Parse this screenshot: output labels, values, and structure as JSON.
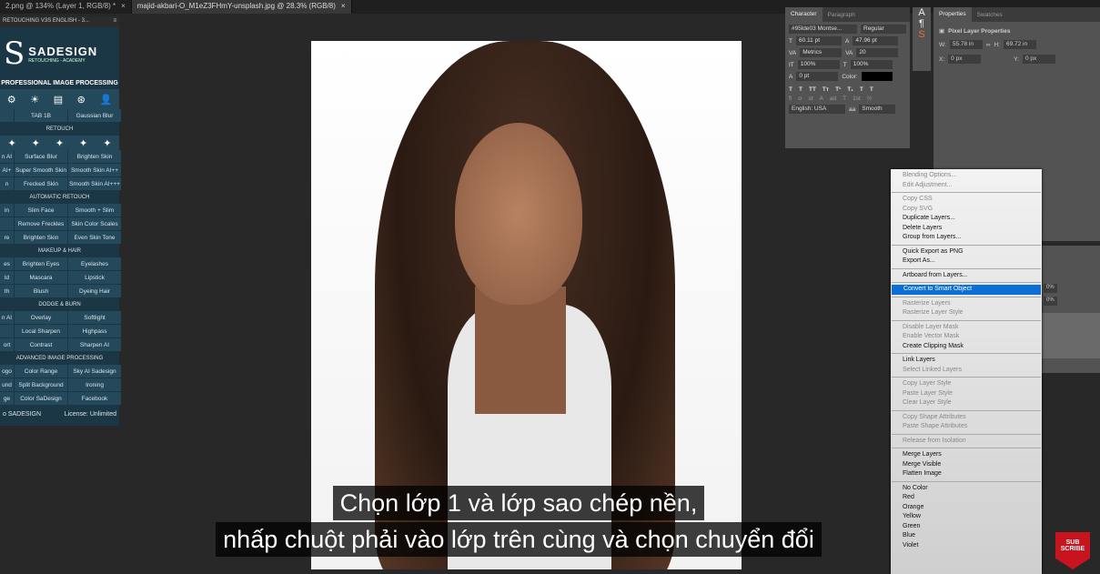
{
  "tabs": [
    {
      "label": "2.png @ 134% (Layer 1, RGB/8) *",
      "close": "×"
    },
    {
      "label": "majid-akbari-O_M1eZ3FHmY-unsplash.jpg @ 28.3% (RGB/8)",
      "close": "×"
    }
  ],
  "sade": {
    "title": "RETOUCHING V3S ENGLISH - 3...",
    "brand": "SADESIGN",
    "brand_sub": "RETOUCHING - ACADEMY",
    "logo_letter": "S",
    "heading": "PROFESSIONAL IMAGE PROCESSING",
    "sections": [
      {
        "header": "",
        "rows": [
          [
            "",
            "TAB 1B",
            "Gaussian Blur"
          ]
        ]
      },
      {
        "header": "RETOUCH",
        "rows": [
          [
            "n AI",
            "Surface Blur",
            "Brighten Skin"
          ],
          [
            "AI+",
            "Super Smooth Skin",
            "Smooth Skin AI++"
          ],
          [
            "n",
            "Frecked Skin",
            "Smooth Skin AI+++"
          ]
        ]
      },
      {
        "header": "AUTOMATIC RETOUCH",
        "rows": [
          [
            "in",
            "Slim Face",
            "Smooth + Slim"
          ],
          [
            "",
            "Remove Freckles",
            "Skin Color Scales"
          ],
          [
            "re",
            "Brighten Skin",
            "Even Skin Tone"
          ]
        ]
      },
      {
        "header": "MAKEUP & HAIR",
        "rows": [
          [
            "es",
            "Brighten Eyes",
            "Eyelashes"
          ],
          [
            "ld",
            "Mascara",
            "Lipstick"
          ],
          [
            "th",
            "Blush",
            "Dyeing Hair"
          ]
        ]
      },
      {
        "header": "DODGE & BURN",
        "rows": [
          [
            "n AI",
            "Overlay",
            "Softlight"
          ],
          [
            "",
            "Local Sharpen",
            "Highpass"
          ],
          [
            "ort",
            "Contrast",
            "Sharpen AI"
          ]
        ]
      },
      {
        "header": "ADVANCED IMAGE PROCESSING",
        "rows": [
          [
            "ogo",
            "Color Range",
            "Sky AI Sadesign"
          ],
          [
            "und",
            "Split Background",
            "Ironing"
          ],
          [
            "ge",
            "Color SaDesign",
            "Facebook"
          ]
        ]
      }
    ],
    "footer_left": "o SADESIGN",
    "footer_right": "License: Unlimited"
  },
  "character": {
    "tab1": "Character",
    "tab2": "Paragraph",
    "font": "#95lde03 Montse...",
    "style": "Regular",
    "size": "60.11 pt",
    "leading": "47.96 pt",
    "kerning": "Metrics",
    "tracking": "20",
    "vscale": "100%",
    "hscale": "100%",
    "baseline": "0 pt",
    "color_label": "Color:",
    "color": "#000000",
    "language": "English: USA",
    "aa_label": "aa",
    "aa": "Smooth",
    "type_buttons": [
      "T",
      "T",
      "TT",
      "Tт",
      "T¹",
      "T₁",
      "T",
      "T"
    ],
    "ot_buttons": [
      "fi",
      "ơ",
      "st",
      "A",
      "ad",
      "T",
      "1st",
      "½"
    ]
  },
  "properties": {
    "tab1": "Properties",
    "tab2": "Swatches",
    "title": "Pixel Layer Properties",
    "w_label": "W:",
    "w": "55.78 in",
    "h_label": "H:",
    "h": "69.72 in",
    "x_label": "X:",
    "x": "0 px",
    "y_label": "Y:",
    "y": "0 px"
  },
  "layers": {
    "opacity": "0%",
    "fill": "0%"
  },
  "menu": [
    [
      "Blending Options...",
      1
    ],
    [
      "Edit Adjustment...",
      1
    ],
    "-",
    [
      "Copy CSS",
      1
    ],
    [
      "Copy SVG",
      1
    ],
    [
      "Duplicate Layers...",
      0
    ],
    [
      "Delete Layers",
      0
    ],
    [
      "Group from Layers...",
      0
    ],
    "-",
    [
      "Quick Export as PNG",
      0
    ],
    [
      "Export As...",
      0
    ],
    "-",
    [
      "Artboard from Layers...",
      0
    ],
    "-",
    [
      "Convert to Smart Object",
      2
    ],
    "-",
    [
      "Rasterize Layers",
      1
    ],
    [
      "Rasterize Layer Style",
      1
    ],
    "-",
    [
      "Disable Layer Mask",
      1
    ],
    [
      "Enable Vector Mask",
      1
    ],
    [
      "Create Clipping Mask",
      0
    ],
    "-",
    [
      "Link Layers",
      0
    ],
    [
      "Select Linked Layers",
      1
    ],
    "-",
    [
      "Copy Layer Style",
      1
    ],
    [
      "Paste Layer Style",
      1
    ],
    [
      "Clear Layer Style",
      1
    ],
    "-",
    [
      "Copy Shape Attributes",
      1
    ],
    [
      "Paste Shape Attributes",
      1
    ],
    "-",
    [
      "Release from Isolation",
      1
    ],
    "-",
    [
      "Merge Layers",
      0
    ],
    [
      "Merge Visible",
      0
    ],
    [
      "Flatten Image",
      0
    ],
    "-",
    [
      "No Color",
      0
    ],
    [
      "Red",
      0
    ],
    [
      "Orange",
      0
    ],
    [
      "Yellow",
      0
    ],
    [
      "Green",
      0
    ],
    [
      "Blue",
      0
    ],
    [
      "Violet",
      0
    ]
  ],
  "subtitles": [
    "Chọn lớp 1 và lớp sao chép nền,",
    "nhấp chuột phải vào lớp trên cùng và chọn chuyển đổi"
  ],
  "subscribe": {
    "line1": "SUB",
    "line2": "SCRIBE"
  }
}
